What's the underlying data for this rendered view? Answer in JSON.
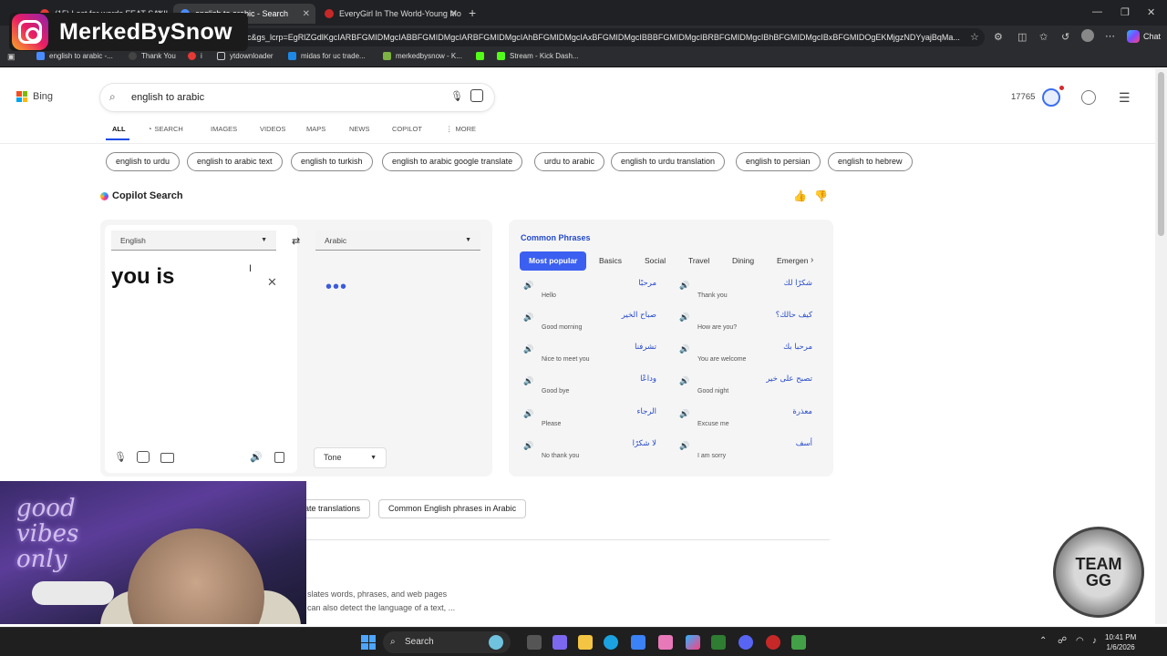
{
  "browser": {
    "tabs": [
      {
        "title": "(15) Lost for words FEAT SALIU",
        "active": false
      },
      {
        "title": "english to arabic - Search",
        "active": true
      },
      {
        "title": "EveryGirl In The World-Young Mo",
        "active": false
      }
    ],
    "url": "bic&gs_lcrp=EgRlZGdlKgcIARBFGMIDMgcIABBFGMIDMgcIARBFGMIDMgcIAhBFGMIDMgcIAxBFGMIDMgcIBBBFGMIDMgcIBRBFGMIDMgcIBhBFGMIDMgcIBxBFGMIDOgEKMjgzNDYyajBqMa...",
    "chat_label": "Chat",
    "bookmarks": [
      "english to arabic -...",
      "Thank You",
      "i",
      "ytdownloader",
      "midas for uc trade...",
      "merkedbysnow - K...",
      "",
      "Stream - Kick Dash..."
    ]
  },
  "overlay": {
    "instagram_name": "MerkedBySnow",
    "badge_text": "TEAM\nGG",
    "neon_text": "good\nvibes\nonly"
  },
  "bing": {
    "logo_text": "Bing",
    "query": "english to arabic",
    "points": "17765",
    "nav_tabs": [
      "ALL",
      "SEARCH",
      "IMAGES",
      "VIDEOS",
      "MAPS",
      "NEWS",
      "COPILOT",
      "MORE"
    ],
    "related_chips": [
      "english to urdu",
      "english to arabic text",
      "english to turkish",
      "english to arabic google translate",
      "urdu to arabic",
      "english to urdu translation",
      "english to persian",
      "english to hebrew"
    ],
    "copilot_title": "Copilot Search",
    "translator": {
      "source_lang": "English",
      "target_lang": "Arabic",
      "source_text": "you is",
      "tone_label": "Tone",
      "dots": "•••"
    },
    "phrases": {
      "title": "Common Phrases",
      "tabs": [
        "Most popular",
        "Basics",
        "Social",
        "Travel",
        "Dining",
        "Emergen"
      ],
      "items": [
        {
          "ar": "مرحبًا",
          "en": "Hello"
        },
        {
          "ar": "شكرًا لك",
          "en": "Thank you"
        },
        {
          "ar": "صباح الخير",
          "en": "Good morning"
        },
        {
          "ar": "كيف حالك؟",
          "en": "How are you?"
        },
        {
          "ar": "تشرفنا",
          "en": "Nice to meet you"
        },
        {
          "ar": "مرحبا بك",
          "en": "You are welcome"
        },
        {
          "ar": "وداعًا",
          "en": "Good bye"
        },
        {
          "ar": "تصبح على خير",
          "en": "Good night"
        },
        {
          "ar": "الرجاء",
          "en": "Please"
        },
        {
          "ar": "معذرة",
          "en": "Excuse me"
        },
        {
          "ar": "لا شكرًا",
          "en": "No thank you"
        },
        {
          "ar": "أسف",
          "en": "I am sorry"
        }
      ]
    },
    "bottom_chips": [
      "ate translations",
      "Common English phrases in Arabic"
    ],
    "snippet_lines": [
      "slates words, phrases, and web pages",
      "can also detect the language of a text, ..."
    ]
  },
  "taskbar": {
    "search_label": "Search",
    "time": "10:41 PM",
    "date": "1/6/2026"
  }
}
